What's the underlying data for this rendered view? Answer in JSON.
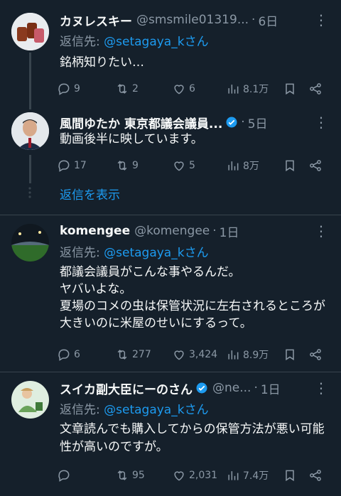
{
  "tweets": [
    {
      "name": "カヌレスキー",
      "handle": "@smsmile01319...",
      "time": "6日",
      "reply_prefix": "返信先: ",
      "reply_handle": "@setagaya_kさん",
      "body": "銘柄知りたい…",
      "replies": "9",
      "retweets": "2",
      "likes": "6",
      "views": "8.1万"
    },
    {
      "name": "風間ゆたか 東京都議会議員...",
      "verified": true,
      "time": "5日",
      "body": "動画後半に映しています。",
      "replies": "17",
      "retweets": "9",
      "likes": "5",
      "views": "8万"
    },
    {
      "name": "komengee",
      "handle": "@komengee",
      "time": "1日",
      "reply_prefix": "返信先: ",
      "reply_handle": "@setagaya_kさん",
      "body": "都議会議員がこんな事やるんだ。\nヤバいよな。\n夏場のコメの虫は保管状況に左右されるところが大きいのに米屋のせいにするって。",
      "replies": "6",
      "retweets": "277",
      "likes": "3,424",
      "views": "8.9万"
    },
    {
      "name": "スイカ副大臣にーのさん",
      "verified": true,
      "handle": "@ne...",
      "time": "1日",
      "reply_prefix": "返信先: ",
      "reply_handle": "@setagaya_kさん",
      "body": "文章読んでも購入してからの保管方法が悪い可能性が高いのですが。",
      "replies": "",
      "retweets": "95",
      "likes": "2,031",
      "views": "7.4万"
    }
  ],
  "show_replies": "返信を表示",
  "colors": {
    "background": "#15202b",
    "accent": "#1d9bf0",
    "muted": "#8b98a5",
    "divider": "#38444d"
  }
}
